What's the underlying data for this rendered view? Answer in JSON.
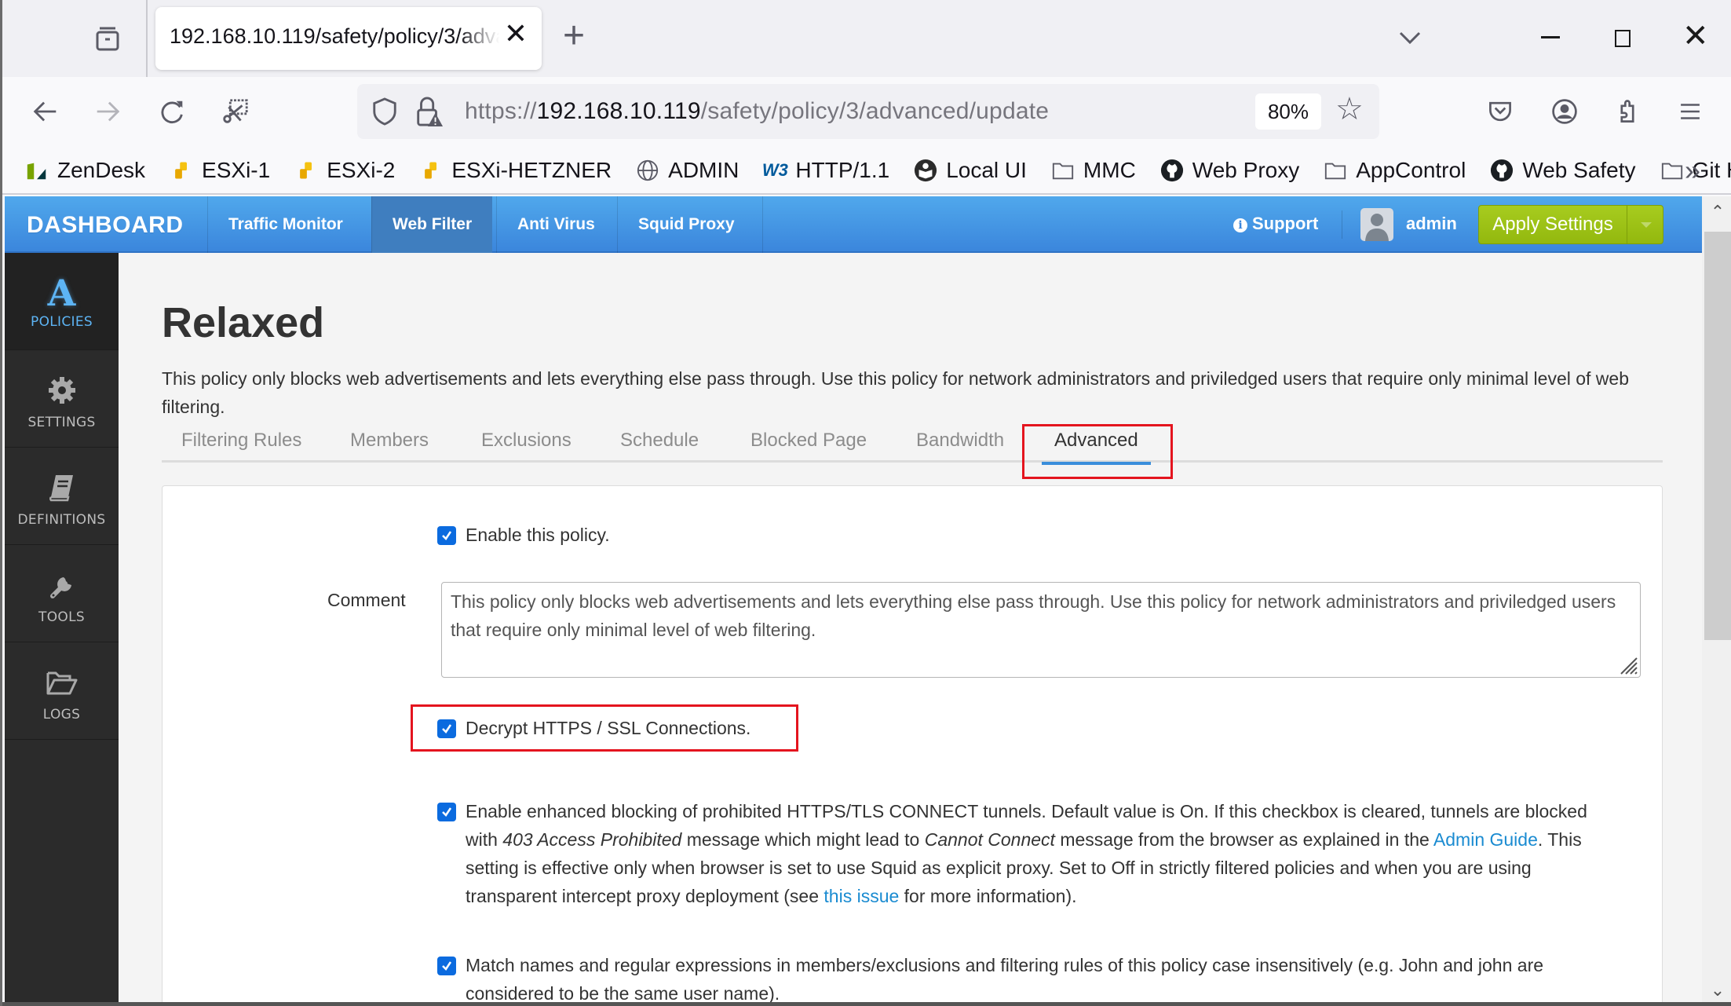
{
  "browser": {
    "tab_title": "192.168.10.119/safety/policy/3/advanced/update",
    "url_scheme": "https://",
    "url_host": "192.168.10.119",
    "url_path": "/safety/policy/3/advanced/update",
    "zoom_level": "80%",
    "bookmarks": [
      {
        "label": "ZenDesk",
        "icon": "zendesk-icon"
      },
      {
        "label": "ESXi-1",
        "icon": "esxi-icon"
      },
      {
        "label": "ESXi-2",
        "icon": "esxi-icon"
      },
      {
        "label": "ESXi-HETZNER",
        "icon": "esxi-icon"
      },
      {
        "label": "ADMIN",
        "icon": "globe-icon"
      },
      {
        "label": "HTTP/1.1",
        "icon": "w3c-icon"
      },
      {
        "label": "Local UI",
        "icon": "book-reader-icon"
      },
      {
        "label": "MMC",
        "icon": "folder-icon"
      },
      {
        "label": "Web Proxy",
        "icon": "github-icon"
      },
      {
        "label": "AppControl",
        "icon": "folder-icon"
      },
      {
        "label": "Web Safety",
        "icon": "github-icon"
      },
      {
        "label": "Git Hub",
        "icon": "folder-icon"
      }
    ],
    "bookmarks_more": "»"
  },
  "app": {
    "brand": "DASHBOARD",
    "topnav": [
      {
        "label": "Traffic Monitor",
        "active": false
      },
      {
        "label": "Web Filter",
        "active": true
      },
      {
        "label": "Anti Virus",
        "active": false
      },
      {
        "label": "Squid Proxy",
        "active": false
      }
    ],
    "support_label": "Support",
    "user_name": "admin",
    "apply_label": "Apply Settings",
    "accent_color": "#3b86dc",
    "apply_color": "#9dc214",
    "sidebar": [
      {
        "label": "POLICIES",
        "icon": "policies-a-icon",
        "active": true
      },
      {
        "label": "SETTINGS",
        "icon": "gear-icon",
        "active": false
      },
      {
        "label": "DEFINITIONS",
        "icon": "book-icon",
        "active": false
      },
      {
        "label": "TOOLS",
        "icon": "wrench-icon",
        "active": false
      },
      {
        "label": "LOGS",
        "icon": "folder-open-icon",
        "active": false
      }
    ]
  },
  "page": {
    "title": "Relaxed",
    "description": "This policy only blocks web advertisements and lets everything else pass through. Use this policy for network administrators and priviledged users that require only minimal level of web filtering.",
    "tabs": [
      {
        "label": "Filtering Rules",
        "active": false
      },
      {
        "label": "Members",
        "active": false
      },
      {
        "label": "Exclusions",
        "active": false
      },
      {
        "label": "Schedule",
        "active": false
      },
      {
        "label": "Blocked Page",
        "active": false
      },
      {
        "label": "Bandwidth",
        "active": false
      },
      {
        "label": "Advanced",
        "active": true
      }
    ],
    "form": {
      "enable_policy": {
        "label": "Enable this policy.",
        "checked": true
      },
      "comment_label": "Comment",
      "comment_value": "This policy only blocks web advertisements and lets everything else pass through. Use this policy for network administrators and priviledged users that require only minimal level of web filtering.",
      "decrypt": {
        "label": "Decrypt HTTPS / SSL Connections.",
        "checked": true
      },
      "enhanced_blocking": {
        "checked": true,
        "text_1": "Enable enhanced blocking of prohibited HTTPS/TLS CONNECT tunnels. Default value is On. If this checkbox is cleared, tunnels are blocked with ",
        "italic_1": "403 Access Prohibited",
        "text_2": " message which might lead to ",
        "italic_2": "Cannot Connect",
        "text_3": " message from the browser as explained in the ",
        "link_1": "Admin Guide",
        "text_4": ". This setting is effective only when browser is set to use Squid as explicit proxy. Set to Off in strictly filtered policies and when you are using transparent intercept proxy deployment (see ",
        "link_2": "this issue",
        "text_5": " for more information)."
      },
      "case_insensitive": {
        "checked": true,
        "label": "Match names and regular expressions in members/exclusions and filtering rules of this policy case insensitively (e.g. John and john are considered to be the same user name)."
      }
    }
  }
}
